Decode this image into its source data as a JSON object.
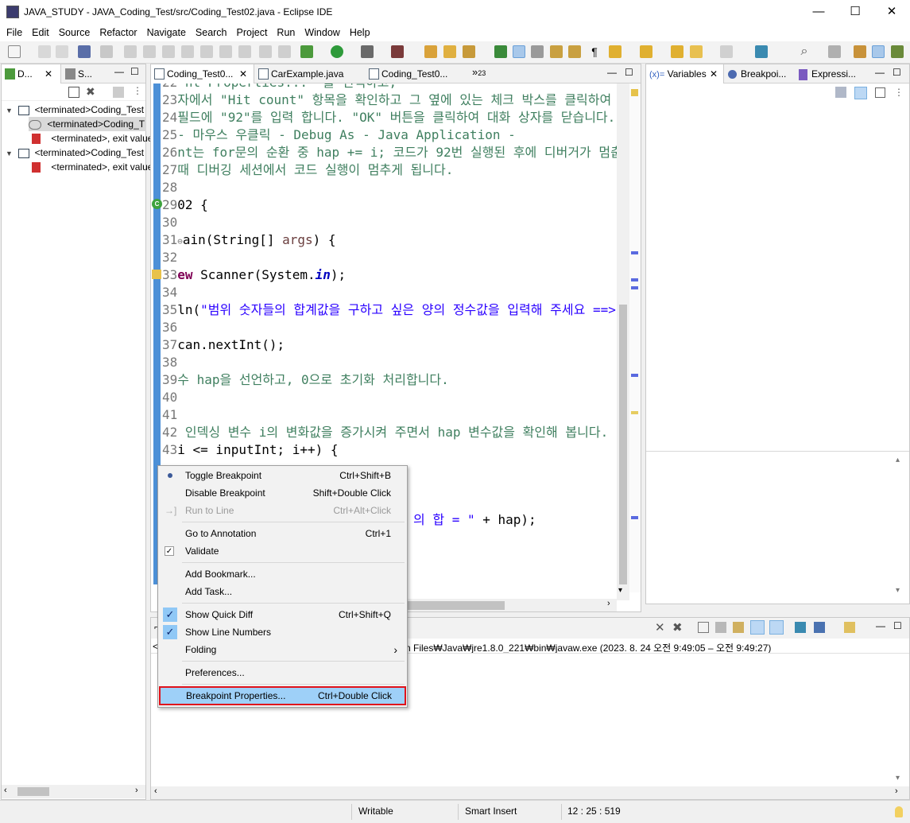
{
  "window": {
    "title": "JAVA_STUDY - JAVA_Coding_Test/src/Coding_Test02.java - Eclipse IDE",
    "minimize": "—",
    "maximize": "☐",
    "close": "✕"
  },
  "menubar": [
    "File",
    "Edit",
    "Source",
    "Refactor",
    "Navigate",
    "Search",
    "Project",
    "Run",
    "Window",
    "Help"
  ],
  "left_panel": {
    "tabs": [
      {
        "label": "D..."
      },
      {
        "label": "S..."
      }
    ],
    "tree": [
      {
        "label": "<terminated>Coding_Test"
      },
      {
        "label": "<terminated>Coding_T"
      },
      {
        "label": "<terminated>, exit value"
      },
      {
        "label": "<terminated>Coding_Test"
      },
      {
        "label": "<terminated>, exit value"
      }
    ]
  },
  "editor": {
    "tabs": [
      {
        "label": "Coding_Test0..."
      },
      {
        "label": "CarExample.java"
      },
      {
        "label": "Coding_Test0..."
      }
    ],
    "overflow_label": "»",
    "overflow_count": "23",
    "lines": {
      "l22": {
        "num": "22",
        "text": " nt Properties...' 를 선택하고,"
      },
      "l23": {
        "num": "23",
        "text": "자에서 \"Hit count\" 항목을 확인하고 그 옆에 있는 체크 박스를 클릭하여 활성"
      },
      "l24": {
        "num": "24",
        "text": "필드에 \"92\"를 입력 합니다. \"OK\" 버튼을 클릭하여 대화 상자를 닫습니다."
      },
      "l25": {
        "num": "25",
        "text": "- 마우스 우클릭 - Debug As - Java Application -"
      },
      "l26": {
        "num": "26",
        "text": "nt는 for문의 순환 중 hap += i; 코드가 92번 실행된 후에 디버거가 멈춥니"
      },
      "l27": {
        "num": "27",
        "text": "때 디버깅 세션에서 코드 실행이 멈추게 됩니다."
      },
      "l28": {
        "num": "28"
      },
      "l29": {
        "num": "29",
        "text": "02 {"
      },
      "l30": {
        "num": "30"
      },
      "l31": {
        "num": "31",
        "marker": "⊖",
        "pre": "ain(String[] ",
        "arg": "args",
        "post": ") {"
      },
      "l32": {
        "num": "32"
      },
      "l33": {
        "num": "33",
        "kw": "ew",
        "pre": " Scanner(System.",
        "fld": "in",
        "post": ");"
      },
      "l34": {
        "num": "34"
      },
      "l35": {
        "num": "35",
        "pre": "ln(",
        "str": "\"범위 숫자들의 합계값을 구하고 싶은 양의 정수값을 입력해 주세요 ==> \"",
        "post": ");"
      },
      "l36": {
        "num": "36"
      },
      "l37": {
        "num": "37",
        "text": "can.nextInt();"
      },
      "l38": {
        "num": "38"
      },
      "l39": {
        "num": "39",
        "text": "수 hap을 선언하고, 0으로 초기화 처리합니다."
      },
      "l40": {
        "num": "40"
      },
      "l41": {
        "num": "41"
      },
      "l42": {
        "num": "42",
        "text": " 인덱싱 변수 i의 변화값을 증가시켜 주면서 hap 변수값을 확인해 봅니다."
      },
      "l43": {
        "num": "43",
        "text": "i <= inputInt; i++) {"
      },
      "l47": {
        "str": "의 합 = \"",
        "post": " + hap);"
      }
    }
  },
  "context_menu": {
    "items": {
      "toggle_breakpoint": {
        "label": "Toggle Breakpoint",
        "shortcut": "Ctrl+Shift+B"
      },
      "disable_breakpoint": {
        "label": "Disable Breakpoint",
        "shortcut": "Shift+Double Click"
      },
      "run_to_line": {
        "label": "Run to Line",
        "shortcut": "Ctrl+Alt+Click"
      },
      "go_to_annotation": {
        "label": "Go to Annotation",
        "shortcut": "Ctrl+1"
      },
      "validate": {
        "label": "Validate"
      },
      "add_bookmark": {
        "label": "Add Bookmark..."
      },
      "add_task": {
        "label": "Add Task..."
      },
      "show_quick_diff": {
        "label": "Show Quick Diff",
        "shortcut": "Ctrl+Shift+Q"
      },
      "show_line_numbers": {
        "label": "Show Line Numbers"
      },
      "folding": {
        "label": "Folding",
        "arrow": "›"
      },
      "preferences": {
        "label": "Preferences..."
      },
      "breakpoint_properties": {
        "label": "Breakpoint Properties...",
        "shortcut": "Ctrl+Double Click"
      }
    },
    "highlight_color": "#e0121b"
  },
  "right_panel": {
    "tabs": [
      {
        "icon": "(x)=",
        "label": "Variables"
      },
      {
        "label": "Breakpoi..."
      },
      {
        "label": "Expressi..."
      }
    ]
  },
  "console": {
    "header_prefix": "<",
    "path_text": "n Files₩Java₩jre1.8.0_221₩bin₩javaw.exe  (2023. 8. 24 오전 9:49:05 – 오전 9:49:27)"
  },
  "statusbar": {
    "mode": "Writable",
    "insert": "Smart Insert",
    "position": "12 : 25 : 519"
  }
}
